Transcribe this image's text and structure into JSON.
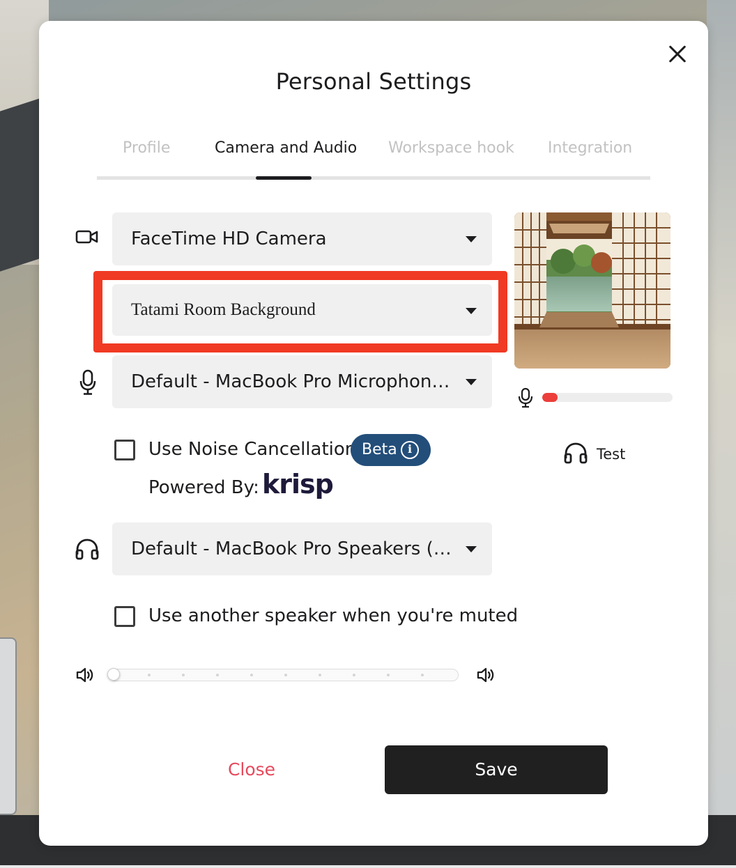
{
  "modal": {
    "title": "Personal Settings",
    "tabs": [
      {
        "label": "Profile",
        "active": false
      },
      {
        "label": "Camera and Audio",
        "active": true
      },
      {
        "label": "Workspace hook",
        "active": false
      },
      {
        "label": "Integration",
        "active": false
      }
    ],
    "camera": {
      "icon": "video-camera-icon",
      "selected": "FaceTime HD Camera"
    },
    "background": {
      "selected": "Tatami Room Background",
      "highlight_color": "#f03a24"
    },
    "microphone": {
      "icon": "microphone-icon",
      "selected": "Default - MacBook Pro Microphone (..."
    },
    "noise_cancellation": {
      "label": "Use Noise Cancellation",
      "checked": false,
      "badge": "Beta",
      "badge_icon": "info-icon",
      "powered_by_label": "Powered By:",
      "provider_logo_text": "krisp"
    },
    "speaker": {
      "icon": "headphones-icon",
      "selected": "Default - MacBook Pro Speakers (Buil..."
    },
    "muted_speaker": {
      "label": "Use another speaker when you're muted",
      "checked": false
    },
    "volume": {
      "low_icon": "volume-low-icon",
      "high_icon": "volume-high-icon",
      "level": 0
    },
    "preview": {
      "description_icon": "camera-preview-image"
    },
    "mic_level": {
      "icon": "microphone-icon",
      "level": 0.12,
      "color": "#ec3e3a"
    },
    "test": {
      "icon": "headphones-icon",
      "label": "Test"
    },
    "buttons": {
      "close": "Close",
      "save": "Save"
    },
    "colors": {
      "accent": "#234e7a",
      "close_text": "#e64a5d",
      "save_bg": "#202020"
    }
  }
}
